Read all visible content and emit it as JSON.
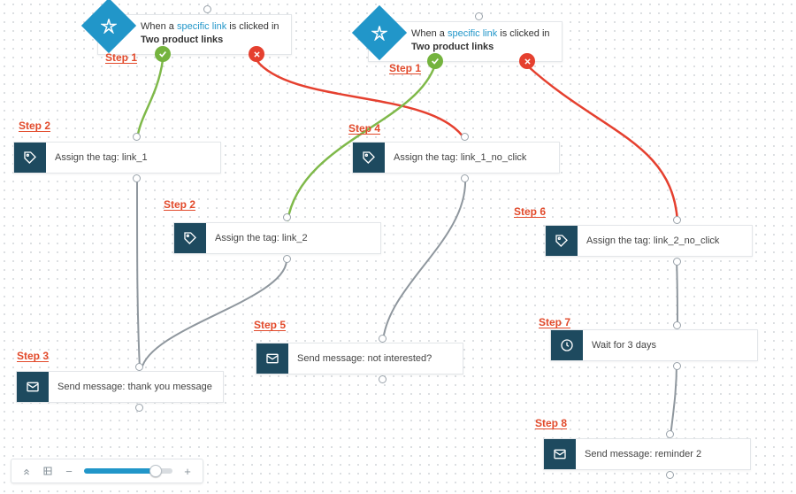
{
  "triggers": [
    {
      "prefix": "When a ",
      "link_text": "specific link",
      "mid": " is clicked in ",
      "bold": "Two product links"
    },
    {
      "prefix": "When a ",
      "link_text": "specific link",
      "mid": " is clicked in ",
      "bold": "Two product links"
    }
  ],
  "labels": {
    "step1a": "Step 1",
    "step1b": "Step 1",
    "step2a": "Step 2",
    "step2b": "Step 2",
    "step3": "Step 3",
    "step4": "Step 4",
    "step5": "Step 5",
    "step6": "Step 6",
    "step7": "Step 7",
    "step8": "Step 8"
  },
  "nodes": {
    "n1": "Assign the tag: link_1",
    "n2": "Assign the tag: link_2",
    "n3": "Send message: thank you message",
    "n4": "Assign the tag: link_1_no_click",
    "n5": "Send message: not interested?",
    "n6": "Assign the tag: link_2_no_click",
    "n7": "Wait for 3 days",
    "n8": "Send message: reminder 2"
  },
  "toolbar": {
    "minus": "−",
    "plus": "+"
  },
  "colors": {
    "teal": "#1e4a5f",
    "blue": "#2196c9",
    "green": "#74b33e",
    "red": "#e5402f",
    "orange": "#e24a2b"
  }
}
